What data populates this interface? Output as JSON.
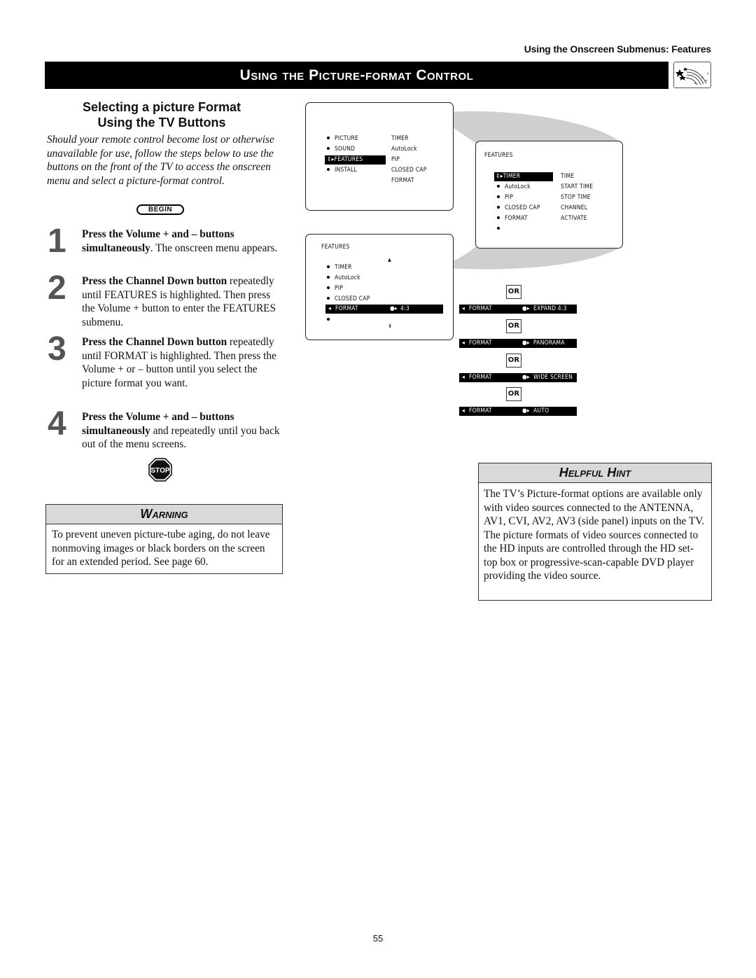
{
  "running_header": "Using the Onscreen Submenus: Features",
  "title_bar": {
    "title": "Using the Picture-format Control",
    "icon": "shooting-stars-icon"
  },
  "section": {
    "heading_line1": "Selecting a picture Format",
    "heading_line2": "Using the TV Buttons",
    "intro": "Should your remote control become lost or otherwise unavailable for use, follow the steps below to use the buttons on the front of the TV to access the onscreen menu and select a picture-format control.",
    "begin_label": "BEGIN"
  },
  "steps": [
    {
      "num": "1",
      "bold": "Press the Volume + and – buttons simultaneously",
      "rest": ". The onscreen menu appears."
    },
    {
      "num": "2",
      "bold": "Press the Channel Down button",
      "rest": " repeatedly until FEATURES is highlighted. Then press the Volume + button to enter the FEATURES submenu."
    },
    {
      "num": "3",
      "bold": "Press the Channel Down button",
      "rest": " repeatedly until FORMAT is highlighted. Then press the Volume + or – button until you select the picture format you want."
    },
    {
      "num": "4",
      "bold": "Press the Volume + and – buttons simultaneously",
      "rest": " and repeatedly until you back out of the menu screens."
    }
  ],
  "stop_label": "STOP",
  "warning": {
    "title": "Warning",
    "body": "To prevent uneven picture-tube aging, do not leave nonmoving images or black borders on the screen for an extended period. See page 60."
  },
  "hint": {
    "title": "Helpful Hint",
    "body": "The TV’s Picture-format options are available only with video sources connected to the ANTENNA, AV1, CVI, AV2, AV3 (side panel) inputs on the TV. The picture formats of video sources connected to the HD inputs are controlled through the HD set-top box or progressive-scan-capable DVD player providing the video source."
  },
  "screen_main": {
    "left_items": [
      "PICTURE",
      "SOUND",
      "FEATURES",
      "INSTALL"
    ],
    "highlighted": "FEATURES",
    "right_items": [
      "TIMER",
      "AutoLock",
      "PIP",
      "CLOSED CAP",
      "FORMAT"
    ]
  },
  "screen_features_timer": {
    "title": "FEATURES",
    "left_items": [
      "TIMER",
      "AutoLock",
      "PIP",
      "CLOSED CAP",
      "FORMAT",
      ""
    ],
    "highlighted": "TIMER",
    "right_items": [
      "TIME",
      "START TIME",
      "STOP TIME",
      "CHANNEL",
      "ACTIVATE"
    ]
  },
  "screen_features_format": {
    "title": "FEATURES",
    "items": [
      "TIMER",
      "AutoLock",
      "PIP",
      "CLOSED CAP",
      "FORMAT",
      ""
    ],
    "highlighted": "FORMAT",
    "format_value": "4:3"
  },
  "format_options": {
    "label": "FORMAT",
    "or_label": "OR",
    "values": [
      "EXPAND 4:3",
      "PANORAMA",
      "WIDE SCREEN",
      "AUTO"
    ]
  },
  "page_number": "55"
}
